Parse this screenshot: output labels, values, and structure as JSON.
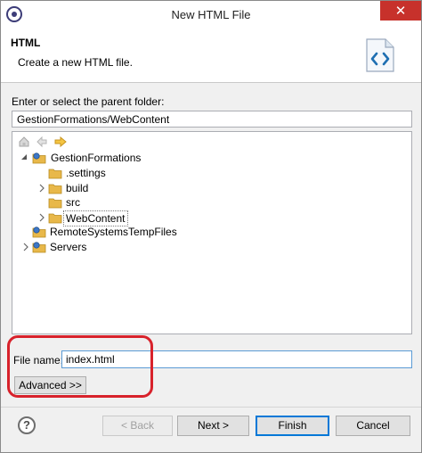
{
  "window": {
    "title": "New HTML File",
    "close_glyph": "✕"
  },
  "header": {
    "title": "HTML",
    "description": "Create a new HTML file.",
    "icon": "html-file-icon"
  },
  "parent_folder": {
    "label": "Enter or select the parent folder:",
    "value": "GestionFormations/WebContent"
  },
  "tree": {
    "nav_icons": [
      "home-icon",
      "back-arrow-icon",
      "forward-arrow-icon"
    ],
    "items": [
      {
        "label": "GestionFormations",
        "level": 1,
        "expanded": true,
        "type": "project"
      },
      {
        "label": ".settings",
        "level": 2,
        "type": "folder"
      },
      {
        "label": "build",
        "level": 2,
        "collapsed": true,
        "type": "folder"
      },
      {
        "label": "src",
        "level": 2,
        "type": "folder"
      },
      {
        "label": "WebContent",
        "level": 2,
        "collapsed": true,
        "type": "folder",
        "selected": true
      },
      {
        "label": "RemoteSystemsTempFiles",
        "level": 1,
        "type": "project"
      },
      {
        "label": "Servers",
        "level": 1,
        "collapsed": true,
        "type": "project"
      }
    ]
  },
  "file_name": {
    "label": "File name:",
    "value": "index.html"
  },
  "advanced_button": "Advanced >>",
  "buttons": {
    "help": "?",
    "back": "< Back",
    "next": "Next >",
    "finish": "Finish",
    "cancel": "Cancel"
  },
  "colors": {
    "highlight_ring": "#d8222b",
    "close_button": "#c7312b",
    "folder": "#e8b84a",
    "focus_border": "#0078d7"
  }
}
